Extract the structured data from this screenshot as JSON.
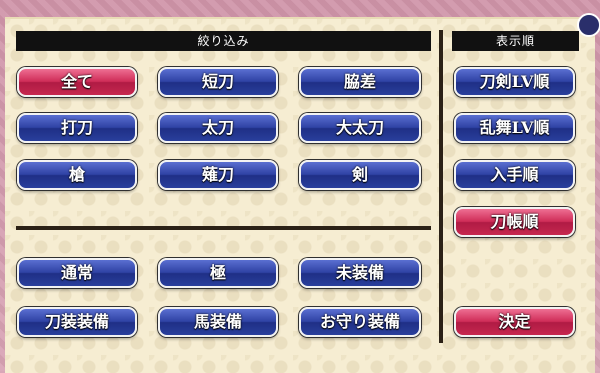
{
  "filter": {
    "header": "絞り込み",
    "rows": [
      [
        {
          "label": "全て",
          "selected": true
        },
        {
          "label": "短刀",
          "selected": false
        },
        {
          "label": "脇差",
          "selected": false
        }
      ],
      [
        {
          "label": "打刀",
          "selected": false
        },
        {
          "label": "太刀",
          "selected": false
        },
        {
          "label": "大太刀",
          "selected": false
        }
      ],
      [
        {
          "label": "槍",
          "selected": false
        },
        {
          "label": "薙刀",
          "selected": false
        },
        {
          "label": "剣",
          "selected": false
        }
      ]
    ],
    "status_rows": [
      [
        {
          "label": "通常",
          "selected": false
        },
        {
          "label": "極",
          "selected": false
        },
        {
          "label": "未装備",
          "selected": false
        }
      ],
      [
        {
          "label": "刀装装備",
          "selected": false
        },
        {
          "label": "馬装備",
          "selected": false
        },
        {
          "label": "お守り装備",
          "selected": false
        }
      ]
    ]
  },
  "sort": {
    "header": "表示順",
    "options": [
      {
        "label": "刀剣LV順",
        "selected": false
      },
      {
        "label": "乱舞LV順",
        "selected": false
      },
      {
        "label": "入手順",
        "selected": false
      },
      {
        "label": "刀帳順",
        "selected": true
      }
    ],
    "confirm_label": "決定"
  },
  "colors": {
    "button_blue": "#2f42a4",
    "button_red": "#cf2d58",
    "panel_bg": "#f6edd2",
    "frame_pink": "#d9a7b8"
  }
}
